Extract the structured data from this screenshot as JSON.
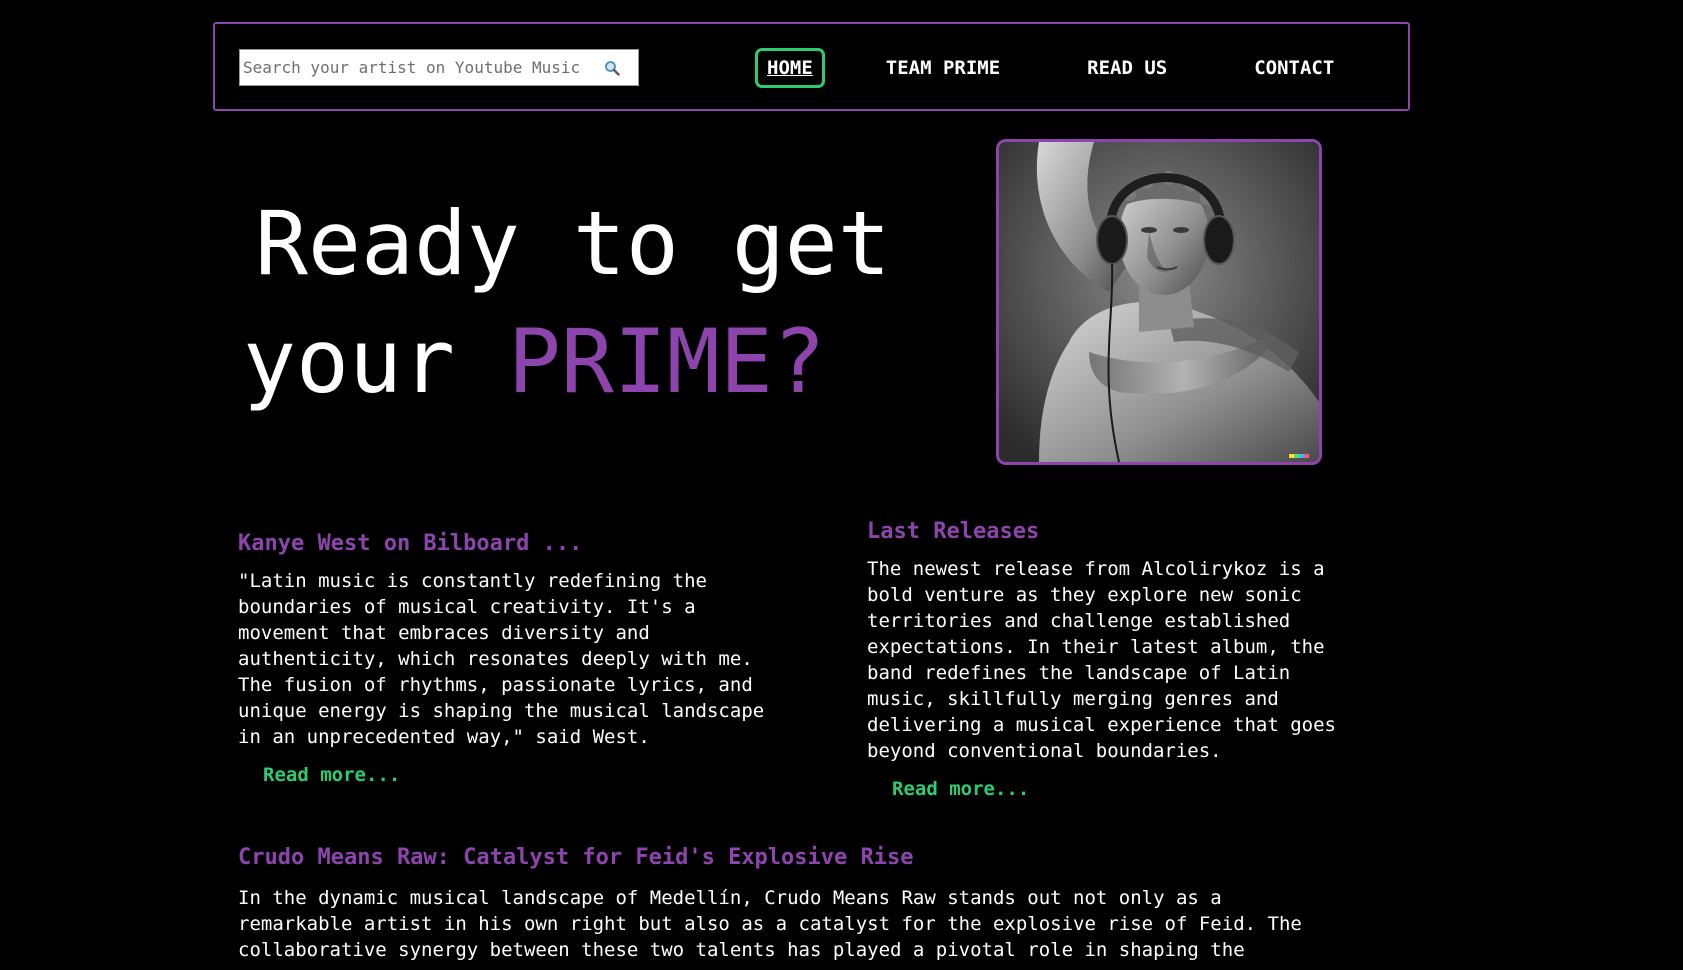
{
  "colors": {
    "background": "#000000",
    "accent_purple": "#8e44ad",
    "accent_green": "#2ecc71",
    "text": "#ffffff"
  },
  "search": {
    "placeholder": "Search your artist on Youtube Music",
    "icon": "search-icon"
  },
  "nav": {
    "home": "HOME",
    "team": "TEAM PRIME",
    "read": "READ US",
    "contact": "CONTACT"
  },
  "hero": {
    "line1": "Ready to get",
    "line2_prefix": "your ",
    "line2_accent": "PRIME?",
    "image_alt": "statue with headphones"
  },
  "articles": {
    "kanye": {
      "title": "Kanye West on Bilboard ...",
      "body": "\"Latin music is constantly redefining the\nboundaries of musical creativity. It's a\nmovement that embraces diversity and\nauthenticity, which resonates deeply with me.\nThe fusion of rhythms, passionate lyrics, and\nunique energy is shaping the musical landscape\nin an unprecedented way,\" said West.",
      "read_more": "Read more..."
    },
    "releases": {
      "title": "Last Releases",
      "body": "The newest release from Alcolirykoz is a\nbold venture as they explore new sonic\nterritories and challenge established\nexpectations. In their latest album, the\nband redefines the landscape of Latin\nmusic, skillfully merging genres and\ndelivering a musical experience that goes\nbeyond conventional boundaries.",
      "read_more": "Read more..."
    },
    "crudo": {
      "title": "Crudo Means Raw: Catalyst for Feid's Explosive Rise",
      "body": "In the dynamic musical landscape of Medellín, Crudo Means Raw stands out not only as a\nremarkable artist in his own right but also as a catalyst for the explosive rise of Feid. The\ncollaborative synergy between these two talents has played a pivotal role in shaping the"
    }
  }
}
